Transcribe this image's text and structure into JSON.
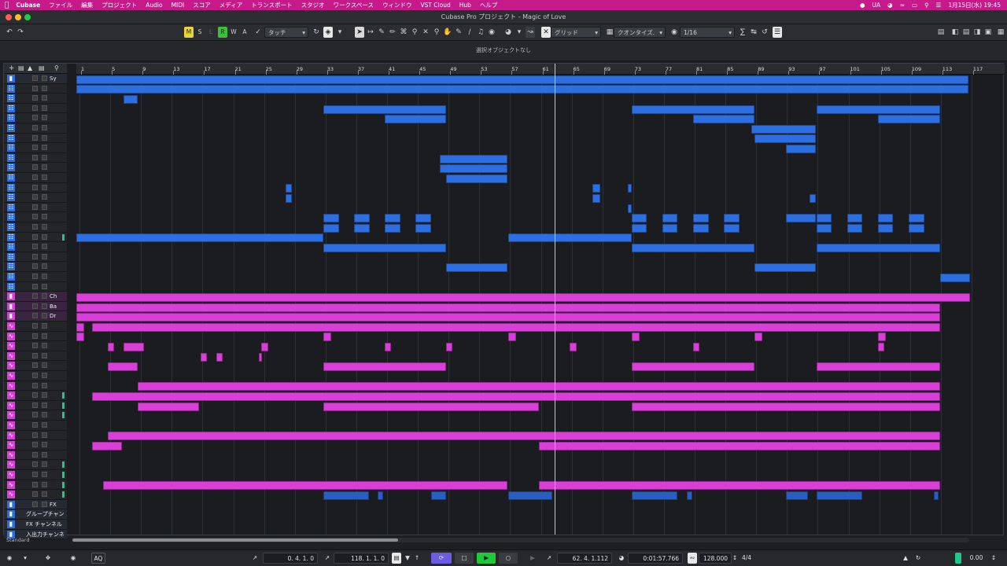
{
  "menubar": {
    "app": "Cubase",
    "items": [
      "ファイル",
      "編集",
      "プロジェクト",
      "Audio",
      "MIDI",
      "スコア",
      "メディア",
      "トランスポート",
      "スタジオ",
      "ワークスペース",
      "ウィンドウ",
      "VST Cloud",
      "Hub",
      "ヘルプ"
    ],
    "status": {
      "input": "UA",
      "datetime": "1月15日(水) 19:45"
    }
  },
  "window": {
    "title": "Cubase Pro プロジェクト - Magic of Love"
  },
  "toolbar": {
    "m": "M",
    "s": "S",
    "l": "L",
    "r": "R",
    "w": "W",
    "a": "A",
    "automation_mode": "タッチ",
    "snap_type": "グリッド",
    "quantize_label": "クオンタイズ.",
    "quantize_value": "1/16"
  },
  "infoline": {
    "text": "選択オブジェクトなし"
  },
  "trackpanel": {
    "header": {
      "m": "m",
      "s": "S",
      "mo": "mo"
    },
    "folders": {
      "sy": "Sy",
      "ch": "Ch",
      "ba": "Ba",
      "dr": "Dr",
      "fx": "FX"
    },
    "bottom": [
      "グループチャン",
      "FX チャンネル",
      "入出力チャンネ"
    ]
  },
  "ruler": {
    "bars": [
      "1",
      "5",
      "9",
      "13",
      "17",
      "21",
      "25",
      "29",
      "33",
      "37",
      "41",
      "45",
      "49",
      "53",
      "57",
      "61",
      "65",
      "69",
      "73",
      "77",
      "81",
      "85",
      "89",
      "93",
      "97",
      "101",
      "105",
      "109",
      "113",
      "117"
    ]
  },
  "status": {
    "mode": "Standard"
  },
  "transport": {
    "left_locator": "0. 4. 1.   0",
    "right_locator": "118. 1. 1.   0",
    "position_bars": "62. 4. 1.112",
    "position_time": "0:01:57.766",
    "tempo": "128.000",
    "signature": "4/4",
    "aq": "AQ",
    "level": "0.00"
  },
  "colors": {
    "menubar": "#c71a8a",
    "midi_event": "#2d6fe0",
    "audio_event": "#d93fd8",
    "transport_play": "#1ec93a",
    "cycle": "#6b5ce0"
  }
}
